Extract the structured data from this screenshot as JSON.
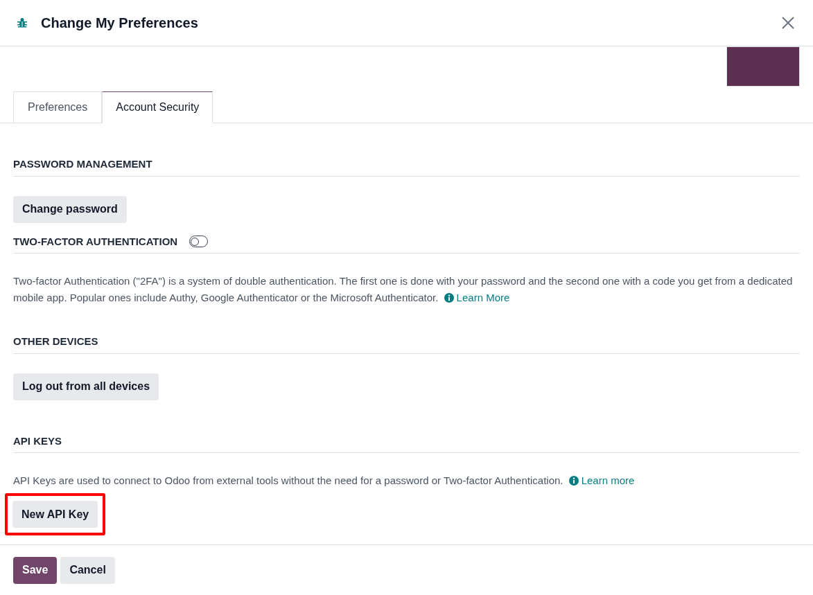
{
  "window": {
    "title": "Change My Preferences"
  },
  "tabs": [
    {
      "label": "Preferences",
      "selected": false
    },
    {
      "label": "Account Security",
      "selected": true
    }
  ],
  "sections": [
    {
      "heading": "PASSWORD MANAGEMENT",
      "button": {
        "label": "Change password",
        "highlighted": false
      }
    },
    {
      "heading": "TWO-FACTOR AUTHENTICATION",
      "toggle": {
        "on": false
      },
      "description": "Two-factor Authentication (\"2FA\") is a system of double authentication. The first one is done with your password and the second one with a code you get from a dedicated mobile app. Popular ones include Authy, Google Authenticator or the Microsoft Authenticator.",
      "link": "Learn More"
    },
    {
      "heading": "OTHER DEVICES",
      "button": {
        "label": "Log out from all devices",
        "highlighted": false
      }
    },
    {
      "heading": "API KEYS",
      "description": "API Keys are used to connect to Odoo from external tools without the need for a password or Two-factor Authentication.",
      "link": "Learn more",
      "button": {
        "label": "New API Key",
        "highlighted": true
      }
    }
  ],
  "footer_buttons": [
    {
      "label": "Save",
      "kind": "primary"
    },
    {
      "label": "Cancel",
      "kind": "secondary"
    }
  ]
}
